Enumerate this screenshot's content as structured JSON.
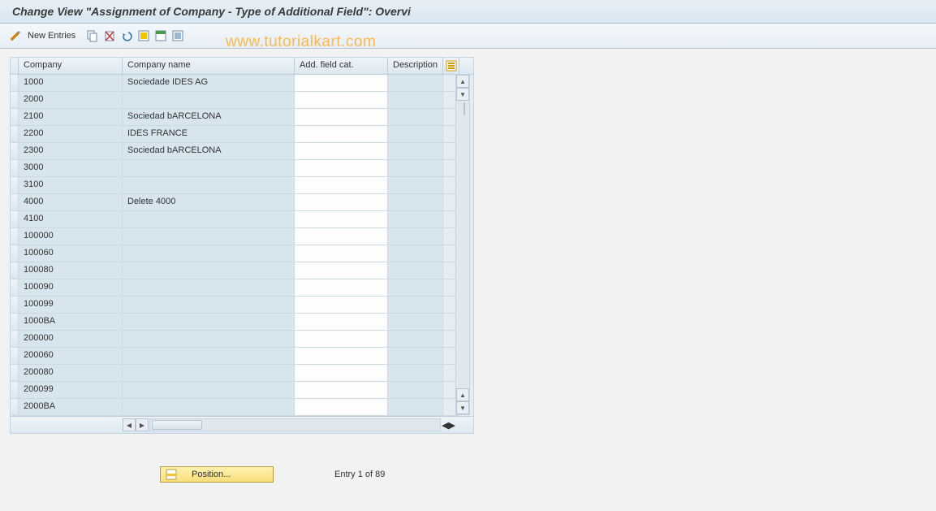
{
  "title": "Change View \"Assignment of Company - Type of Additional Field\": Overvi",
  "watermark": "www.tutorialkart.com",
  "toolbar": {
    "new_entries_label": "New Entries"
  },
  "table": {
    "headers": {
      "company": "Company",
      "company_name": "Company name",
      "add_field_cat": "Add. field cat.",
      "description": "Description"
    },
    "rows": [
      {
        "company": "1000",
        "name": "Sociedade IDES AG",
        "cat": "",
        "desc": ""
      },
      {
        "company": "2000",
        "name": "",
        "cat": "",
        "desc": ""
      },
      {
        "company": "2100",
        "name": "Sociedad bARCELONA",
        "cat": "",
        "desc": ""
      },
      {
        "company": "2200",
        "name": "IDES FRANCE",
        "cat": "",
        "desc": ""
      },
      {
        "company": "2300",
        "name": "Sociedad bARCELONA",
        "cat": "",
        "desc": ""
      },
      {
        "company": "3000",
        "name": "",
        "cat": "",
        "desc": ""
      },
      {
        "company": "3100",
        "name": "",
        "cat": "",
        "desc": ""
      },
      {
        "company": "4000",
        "name": "Delete 4000",
        "cat": "",
        "desc": ""
      },
      {
        "company": "4100",
        "name": "",
        "cat": "",
        "desc": ""
      },
      {
        "company": "100000",
        "name": "",
        "cat": "",
        "desc": ""
      },
      {
        "company": "100060",
        "name": "",
        "cat": "",
        "desc": ""
      },
      {
        "company": "100080",
        "name": "",
        "cat": "",
        "desc": ""
      },
      {
        "company": "100090",
        "name": "",
        "cat": "",
        "desc": ""
      },
      {
        "company": "100099",
        "name": "",
        "cat": "",
        "desc": ""
      },
      {
        "company": "1000BA",
        "name": "",
        "cat": "",
        "desc": ""
      },
      {
        "company": "200000",
        "name": "",
        "cat": "",
        "desc": ""
      },
      {
        "company": "200060",
        "name": "",
        "cat": "",
        "desc": ""
      },
      {
        "company": "200080",
        "name": "",
        "cat": "",
        "desc": ""
      },
      {
        "company": "200099",
        "name": "",
        "cat": "",
        "desc": ""
      },
      {
        "company": "2000BA",
        "name": "",
        "cat": "",
        "desc": ""
      }
    ]
  },
  "footer": {
    "position_label": "Position...",
    "entry_text": "Entry 1 of 89"
  }
}
